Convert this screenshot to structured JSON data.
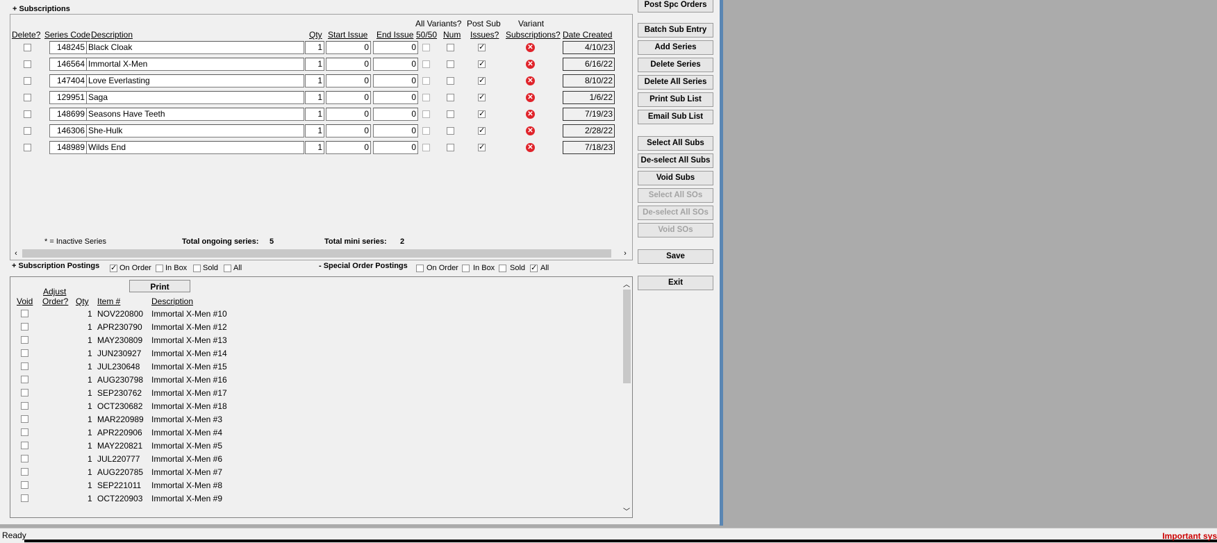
{
  "subscriptions": {
    "title": "+ Subscriptions",
    "headers": {
      "delete": "Delete?",
      "series_code": "Series Code",
      "description": "Description",
      "qty": "Qty",
      "start_issue": "Start Issue",
      "end_issue": "End Issue",
      "variants_top": "All Variants?",
      "variants_5050": "50/50",
      "variants_num": "Num",
      "post_sub_top": "Post Sub",
      "post_sub_bottom": "Issues?",
      "variant_subs_top": "Variant",
      "variant_subs_bottom": "Subscriptions?",
      "date_created": "Date Created"
    },
    "rows": [
      {
        "code": "148245",
        "description": "Black Cloak",
        "qty": "1",
        "start": "0",
        "end": "0",
        "date": "4/10/23"
      },
      {
        "code": "146564",
        "description": "Immortal X-Men",
        "qty": "1",
        "start": "0",
        "end": "0",
        "date": "6/16/22"
      },
      {
        "code": "147404",
        "description": "Love Everlasting",
        "qty": "1",
        "start": "0",
        "end": "0",
        "date": "8/10/22"
      },
      {
        "code": "129951",
        "description": "Saga",
        "qty": "1",
        "start": "0",
        "end": "0",
        "date": "1/6/22"
      },
      {
        "code": "148699",
        "description": "Seasons Have Teeth",
        "qty": "1",
        "start": "0",
        "end": "0",
        "date": "7/19/23"
      },
      {
        "code": "146306",
        "description": "She-Hulk",
        "qty": "1",
        "start": "0",
        "end": "0",
        "date": "2/28/22"
      },
      {
        "code": "148989",
        "description": "Wilds End",
        "qty": "1",
        "start": "0",
        "end": "0",
        "date": "7/18/23"
      }
    ],
    "inactive_note": "* = Inactive Series",
    "total_ongoing_label": "Total ongoing series:",
    "total_ongoing_value": "5",
    "total_mini_label": "Total mini series:",
    "total_mini_value": "2"
  },
  "postings": {
    "sub_title": "+ Subscription Postings",
    "sub_filters": [
      {
        "label": "On Order",
        "checked": true
      },
      {
        "label": "In Box",
        "checked": false
      },
      {
        "label": "Sold",
        "checked": false
      },
      {
        "label": "All",
        "checked": false
      }
    ],
    "spc_title": "- Special Order Postings",
    "spc_filters": [
      {
        "label": "On Order",
        "checked": false
      },
      {
        "label": "In Box",
        "checked": false
      },
      {
        "label": "Sold",
        "checked": false
      },
      {
        "label": "All",
        "checked": true
      }
    ],
    "print_label": "Print",
    "headers": {
      "void": "Void",
      "adjust_top": "Adjust",
      "adjust_bottom": "Order?",
      "qty": "Qty",
      "item": "Item #",
      "description": "Description"
    },
    "rows": [
      {
        "qty": "1",
        "item": "NOV220800",
        "description": "Immortal X-Men #10"
      },
      {
        "qty": "1",
        "item": "APR230790",
        "description": "Immortal X-Men #12"
      },
      {
        "qty": "1",
        "item": "MAY230809",
        "description": "Immortal X-Men #13"
      },
      {
        "qty": "1",
        "item": "JUN230927",
        "description": "Immortal X-Men #14"
      },
      {
        "qty": "1",
        "item": "JUL230648",
        "description": "Immortal X-Men #15"
      },
      {
        "qty": "1",
        "item": "AUG230798",
        "description": "Immortal X-Men #16"
      },
      {
        "qty": "1",
        "item": "SEP230762",
        "description": "Immortal X-Men #17"
      },
      {
        "qty": "1",
        "item": "OCT230682",
        "description": "Immortal X-Men #18"
      },
      {
        "qty": "1",
        "item": "MAR220989",
        "description": "Immortal X-Men #3"
      },
      {
        "qty": "1",
        "item": "APR220906",
        "description": "Immortal X-Men #4"
      },
      {
        "qty": "1",
        "item": "MAY220821",
        "description": "Immortal X-Men #5"
      },
      {
        "qty": "1",
        "item": "JUL220777",
        "description": "Immortal X-Men #6"
      },
      {
        "qty": "1",
        "item": "AUG220785",
        "description": "Immortal X-Men #7"
      },
      {
        "qty": "1",
        "item": "SEP221011",
        "description": "Immortal X-Men #8"
      },
      {
        "qty": "1",
        "item": "OCT220903",
        "description": "Immortal X-Men #9"
      }
    ]
  },
  "buttons": {
    "post_spc_orders": "Post Spc Orders",
    "batch_sub_entry": "Batch Sub Entry",
    "add_series": "Add Series",
    "delete_series": "Delete Series",
    "delete_all_series": "Delete All Series",
    "print_sub_list": "Print Sub List",
    "email_sub_list": "Email Sub List",
    "select_all_subs": "Select All Subs",
    "deselect_all_subs": "De-select All Subs",
    "void_subs": "Void Subs",
    "select_all_sos": "Select All SOs",
    "deselect_all_sos": "De-select All SOs",
    "void_sos": "Void SOs",
    "save": "Save",
    "exit": "Exit"
  },
  "status": {
    "ready": "Ready",
    "important": "Important sys"
  },
  "colors": {
    "accent_red": "#e0242b",
    "status_red": "#cc0000",
    "window_border": "#5a86b3"
  }
}
